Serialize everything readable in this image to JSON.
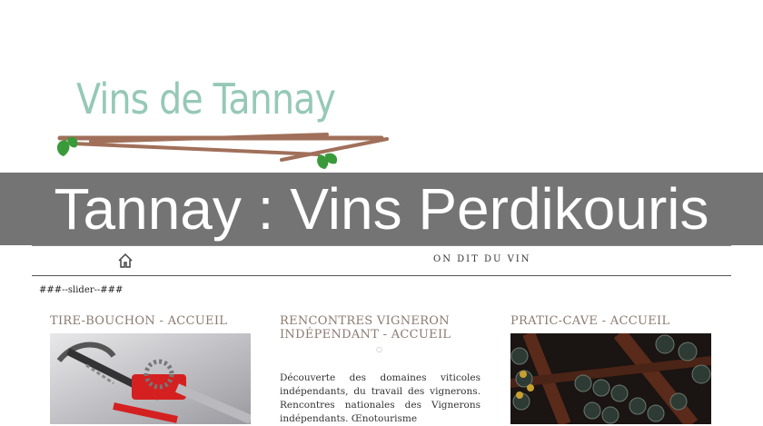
{
  "logo": {
    "text": "Vins de Tannay"
  },
  "banner": {
    "title": "Tannay : Vins Perdikouris"
  },
  "nav": {
    "link_label": "ON DIT DU VIN"
  },
  "slider_text": "###--slider--###",
  "columns": [
    {
      "title": "TIRE-BOUCHON - ACCUEIL"
    },
    {
      "title": "RENCONTRES VIGNERON INDÉPENDANT - ACCUEIL",
      "description": "Découverte des domaines viticoles indépendants, du travail des vignerons. Rencontres nationales des Vignerons indépendants. Œnotourisme"
    },
    {
      "title": "PRATIC-CAVE - ACCUEIL"
    }
  ],
  "colors": {
    "logo": "#96c8b8",
    "banner_bg": "#6e6e6e",
    "heading": "#8a7a70",
    "branch": "#a0705a",
    "leaf": "#3a9a3a"
  },
  "icons": {
    "home": "home-icon"
  }
}
